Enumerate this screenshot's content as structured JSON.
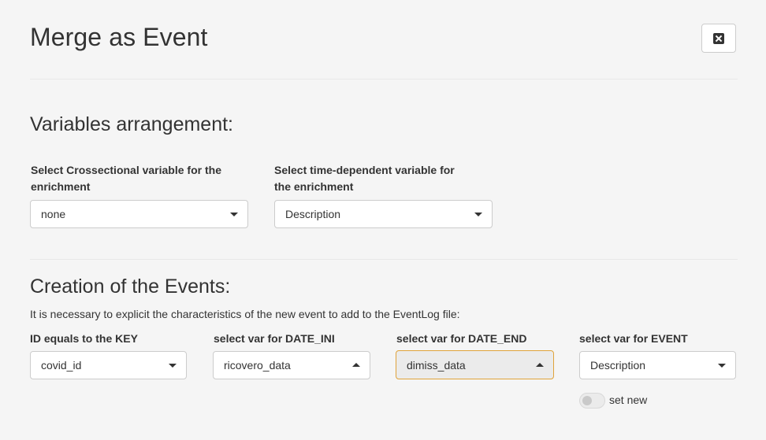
{
  "modal": {
    "title": "Merge as Event",
    "close_icon": "close-icon"
  },
  "variables_section": {
    "title": "Variables arrangement:",
    "crossectional": {
      "label_line1": "Select Crossectional variable for the",
      "label_line2": "enrichment",
      "value": "none"
    },
    "time_dependent": {
      "label_line1": "Select time-dependent variable for",
      "label_line2": "the enrichment",
      "value": "Description"
    }
  },
  "events_section": {
    "title": "Creation of the Events:",
    "help": "It is necessary to explicit the characteristics of the new event to add to the EventLog file:",
    "id_key": {
      "label": "ID equals to the KEY",
      "value": "covid_id"
    },
    "date_ini": {
      "label": "select var for DATE_INI",
      "value": "ricovero_data"
    },
    "date_end": {
      "label": "select var for DATE_END",
      "value": "dimiss_data"
    },
    "event": {
      "label": "select var for EVENT",
      "value": "Description"
    },
    "set_new": {
      "label": "set new",
      "on": false
    }
  },
  "colors": {
    "background": "#f5f5f5",
    "focus_border": "#e0a33a",
    "text": "#333333"
  }
}
